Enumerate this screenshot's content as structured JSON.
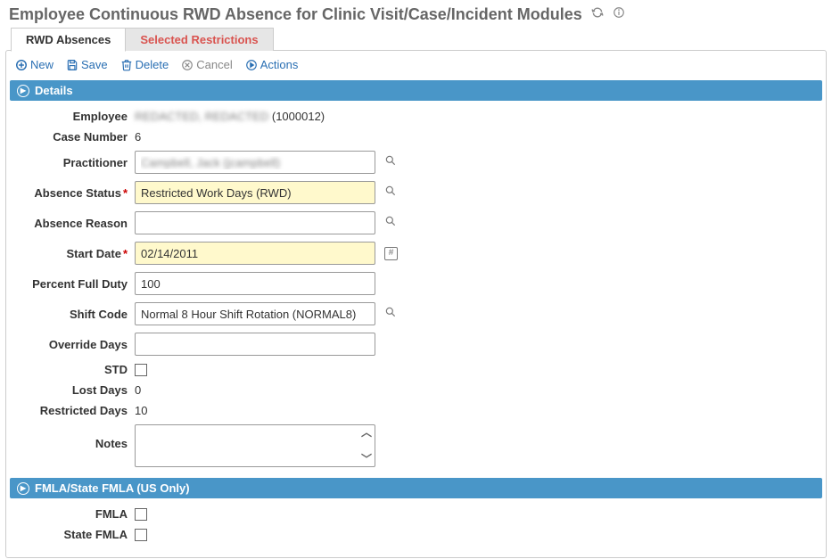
{
  "header": {
    "title": "Employee Continuous RWD Absence for Clinic Visit/Case/Incident Modules"
  },
  "tabs": [
    {
      "label": "RWD Absences",
      "active": true
    },
    {
      "label": "Selected Restrictions",
      "active": false
    }
  ],
  "toolbar": {
    "new": "New",
    "save": "Save",
    "delete": "Delete",
    "cancel": "Cancel",
    "actions": "Actions"
  },
  "sections": {
    "details": {
      "title": "Details",
      "fields": {
        "employee_label": "Employee",
        "employee_value_name": "REDACTED, REDACTED",
        "employee_value_id": " (1000012)",
        "case_number_label": "Case Number",
        "case_number_value": "6",
        "practitioner_label": "Practitioner",
        "practitioner_value": "Campbell, Jack (jcampbell)",
        "absence_status_label": "Absence Status",
        "absence_status_value": "Restricted Work Days (RWD)",
        "absence_reason_label": "Absence Reason",
        "absence_reason_value": "",
        "start_date_label": "Start Date",
        "start_date_value": "02/14/2011",
        "percent_full_duty_label": "Percent Full Duty",
        "percent_full_duty_value": "100",
        "shift_code_label": "Shift Code",
        "shift_code_value": "Normal 8 Hour Shift Rotation (NORMAL8)",
        "override_days_label": "Override Days",
        "override_days_value": "",
        "std_label": "STD",
        "std_checked": false,
        "lost_days_label": "Lost Days",
        "lost_days_value": "0",
        "restricted_days_label": "Restricted Days",
        "restricted_days_value": "10",
        "notes_label": "Notes",
        "notes_value": ""
      }
    },
    "fmla": {
      "title": "FMLA/State FMLA (US Only)",
      "fields": {
        "fmla_label": "FMLA",
        "fmla_checked": false,
        "state_fmla_label": "State FMLA",
        "state_fmla_checked": false
      }
    }
  }
}
